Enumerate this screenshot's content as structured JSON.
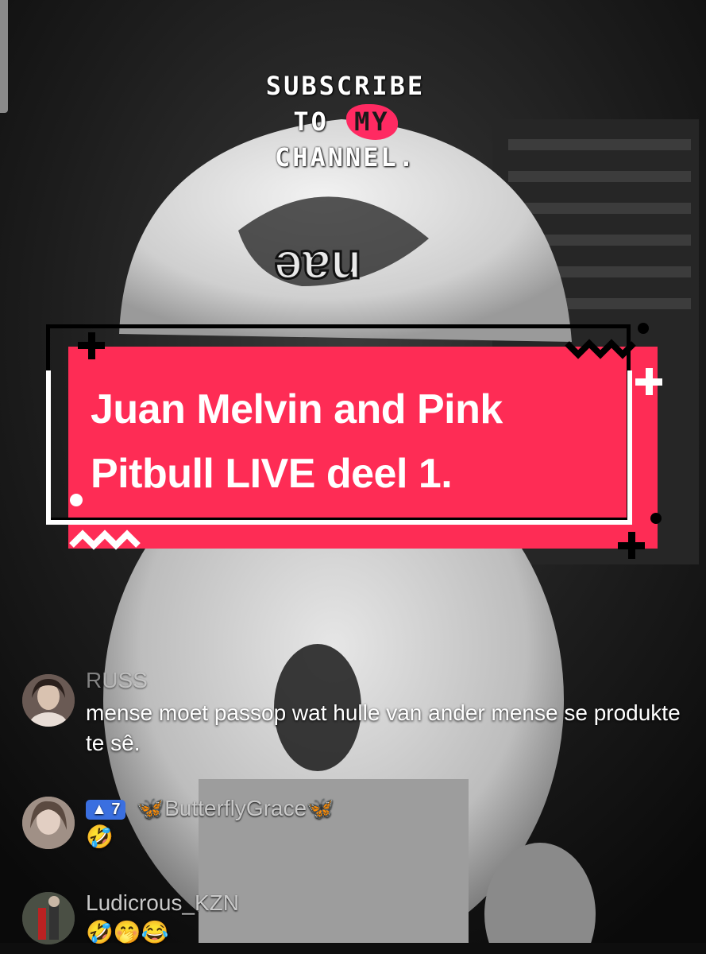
{
  "overlay": {
    "subscribe_line1": "SUBSCRIBE",
    "subscribe_line2_prefix": "TO",
    "subscribe_line2_highlight": "MY",
    "subscribe_line3": "CHANNEL.",
    "accent_color": "#fe2c55"
  },
  "title": {
    "line1": "Juan Melvin and Pink",
    "line2": "Pitbull LIVE deel 1."
  },
  "comments": [
    {
      "username": "RUSS",
      "text": "mense moet passop wat hulle van ander mense se produkte te sê."
    },
    {
      "badge": "7",
      "username": "🦋ButterflyGrace🦋",
      "text": "🤣"
    },
    {
      "username": "Ludicrous_KZN",
      "text": "🤣🤭😂"
    }
  ]
}
